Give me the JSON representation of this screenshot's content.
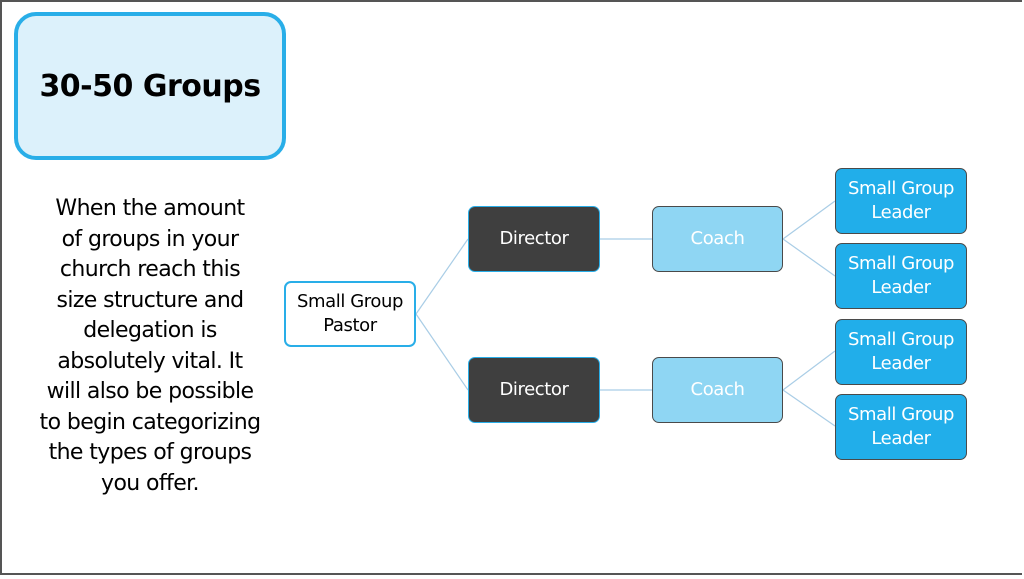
{
  "slide": {
    "title": "30-50 Groups",
    "description": "When the amount of groups in your church reach this size structure and delegation is absolutely vital.  It will also be possible to begin categorizing the types of groups you offer.",
    "description_lines": [
      "When the amount",
      "of groups in your",
      "church reach this",
      "size structure and",
      "delegation is",
      "absolutely vital.  It",
      "will also be possible",
      "to begin categorizing",
      "the types of groups",
      "you offer."
    ]
  },
  "org_chart": {
    "root": {
      "label_line1": "Small Group",
      "label_line2": "Pastor"
    },
    "directors": [
      {
        "label": "Director",
        "coach": {
          "label": "Coach",
          "leaders": [
            {
              "label_line1": "Small Group",
              "label_line2": "Leader"
            },
            {
              "label_line1": "Small Group",
              "label_line2": "Leader"
            }
          ]
        }
      },
      {
        "label": "Director",
        "coach": {
          "label": "Coach",
          "leaders": [
            {
              "label_line1": "Small Group",
              "label_line2": "Leader"
            },
            {
              "label_line1": "Small Group",
              "label_line2": "Leader"
            }
          ]
        }
      }
    ]
  },
  "colors": {
    "title_border": "#29aee8",
    "title_fill": "#dcf1fb",
    "director_fill": "#3f3f3f",
    "coach_fill": "#8fd6f3",
    "leader_fill": "#21aeea",
    "connector": "#a9cde6"
  }
}
